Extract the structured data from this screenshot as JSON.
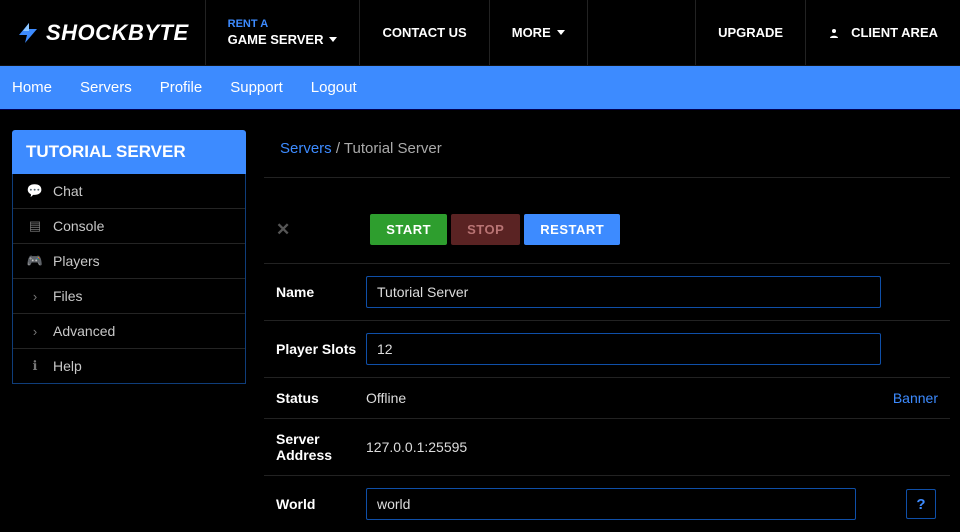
{
  "brand": "SHOCKBYTE",
  "topnav": {
    "rent_small": "RENT A",
    "rent_main": "GAME SERVER",
    "contact": "CONTACT US",
    "more": "MORE",
    "upgrade": "UPGRADE",
    "client_area": "CLIENT AREA"
  },
  "subnav": {
    "home": "Home",
    "servers": "Servers",
    "profile": "Profile",
    "support": "Support",
    "logout": "Logout"
  },
  "sidebar": {
    "title": "TUTORIAL SERVER",
    "chat": "Chat",
    "console": "Console",
    "players": "Players",
    "files": "Files",
    "advanced": "Advanced",
    "help": "Help"
  },
  "breadcrumb": {
    "servers": "Servers",
    "sep": " / ",
    "current": "Tutorial Server"
  },
  "controls": {
    "start": "START",
    "stop": "STOP",
    "restart": "RESTART"
  },
  "labels": {
    "name": "Name",
    "player_slots": "Player Slots",
    "status": "Status",
    "server_address": "Server Address",
    "world": "World",
    "banner": "Banner",
    "help_q": "?"
  },
  "values": {
    "name": "Tutorial Server",
    "player_slots": "12",
    "status": "Offline",
    "server_address": "127.0.0.1:25595",
    "world": "world"
  }
}
